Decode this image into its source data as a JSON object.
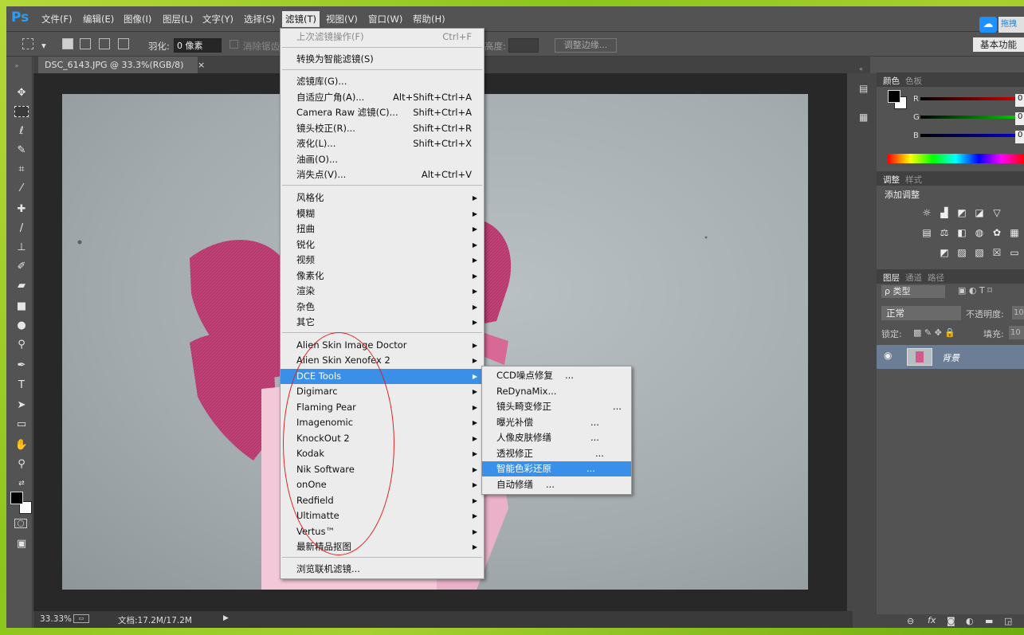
{
  "app": {
    "logo": "Ps"
  },
  "menubar": {
    "items": [
      "文件(F)",
      "编辑(E)",
      "图像(I)",
      "图层(L)",
      "文字(Y)",
      "选择(S)",
      "滤镜(T)",
      "视图(V)",
      "窗口(W)",
      "帮助(H)"
    ],
    "active": "滤镜(T)",
    "top_right_label": "拖拽"
  },
  "options_bar": {
    "feather_label": "羽化:",
    "feather_value": "0 像素",
    "antialias_label": "消除锯齿",
    "height_label": "高度:",
    "refine_edge_label": "调整边缘...",
    "workspace_label": "基本功能"
  },
  "document": {
    "tab_title": "DSC_6143.JPG @ 33.3%(RGB/8)",
    "tab_close": "×",
    "zoom": "33.33%",
    "doc_size": "文档:17.2M/17.2M"
  },
  "filter_menu": {
    "items": [
      {
        "label": "上次滤镜操作(F)",
        "shortcut": "Ctrl+F",
        "disabled": true
      },
      {
        "label": "转换为智能滤镜(S)"
      },
      {
        "label": "滤镜库(G)..."
      },
      {
        "label": "自适应广角(A)...",
        "shortcut": "Alt+Shift+Ctrl+A"
      },
      {
        "label": "Camera Raw 滤镜(C)...",
        "shortcut": "Shift+Ctrl+A"
      },
      {
        "label": "镜头校正(R)...",
        "shortcut": "Shift+Ctrl+R"
      },
      {
        "label": "液化(L)...",
        "shortcut": "Shift+Ctrl+X"
      },
      {
        "label": "油画(O)..."
      },
      {
        "label": "消失点(V)...",
        "shortcut": "Alt+Ctrl+V"
      },
      {
        "label": "风格化",
        "submenu": true
      },
      {
        "label": "模糊",
        "submenu": true
      },
      {
        "label": "扭曲",
        "submenu": true
      },
      {
        "label": "锐化",
        "submenu": true
      },
      {
        "label": "视频",
        "submenu": true
      },
      {
        "label": "像素化",
        "submenu": true
      },
      {
        "label": "渲染",
        "submenu": true
      },
      {
        "label": "杂色",
        "submenu": true
      },
      {
        "label": "其它",
        "submenu": true
      },
      {
        "label": "Alien Skin Image Doctor",
        "submenu": true
      },
      {
        "label": "Alien Skin Xenofex 2",
        "submenu": true
      },
      {
        "label": "DCE Tools",
        "submenu": true,
        "highlighted": true
      },
      {
        "label": "Digimarc",
        "submenu": true
      },
      {
        "label": "Flaming Pear",
        "submenu": true
      },
      {
        "label": "Imagenomic",
        "submenu": true
      },
      {
        "label": "KnockOut 2",
        "submenu": true
      },
      {
        "label": "Kodak",
        "submenu": true
      },
      {
        "label": "Nik Software",
        "submenu": true
      },
      {
        "label": "onOne",
        "submenu": true
      },
      {
        "label": "Redfield",
        "submenu": true
      },
      {
        "label": "Ultimatte",
        "submenu": true
      },
      {
        "label": "Vertus™",
        "submenu": true
      },
      {
        "label": "最新精品抠图",
        "submenu": true
      },
      {
        "label": "浏览联机滤镜..."
      }
    ]
  },
  "dce_submenu": {
    "items": [
      {
        "label": "CCD噪点修复",
        "dots": "..."
      },
      {
        "label": "ReDynaMix...",
        "dots": ""
      },
      {
        "label": "镜头畸变修正",
        "dots": "..."
      },
      {
        "label": "曝光补偿",
        "dots": "..."
      },
      {
        "label": "人像皮肤修缮",
        "dots": "..."
      },
      {
        "label": "透视修正",
        "dots": "..."
      },
      {
        "label": "智能色彩还原",
        "dots": "...",
        "highlighted": true
      },
      {
        "label": "自动修缮",
        "dots": "..."
      }
    ]
  },
  "color_panel": {
    "tabs": [
      "颜色",
      "色板"
    ],
    "channels": [
      {
        "name": "R",
        "value": "0"
      },
      {
        "name": "G",
        "value": "0"
      },
      {
        "name": "B",
        "value": "0"
      }
    ]
  },
  "adjust_panel": {
    "tabs": [
      "调整",
      "样式"
    ],
    "title": "添加调整"
  },
  "layers_panel": {
    "tabs": [
      "图层",
      "通道",
      "路径"
    ],
    "filter_kind": "ρ 类型",
    "blend_mode": "正常",
    "opacity_label": "不透明度:",
    "opacity_value": "10",
    "lock_label": "锁定:",
    "fill_label": "填充:",
    "fill_value": "10",
    "layer_name": "背景"
  },
  "colors": {
    "accent": "#3a8fe8",
    "annotation": "#d22222",
    "canvas_bg": "#a7afb2",
    "fabric": "#c2447a"
  }
}
